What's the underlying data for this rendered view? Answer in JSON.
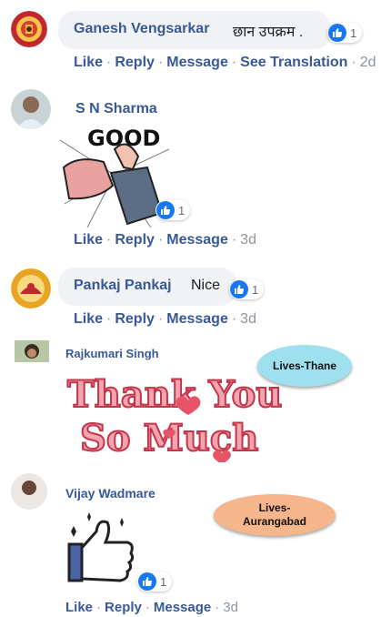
{
  "actions": {
    "like": "Like",
    "reply": "Reply",
    "message": "Message",
    "see_translation": "See Translation",
    "sep": "·"
  },
  "comments": [
    {
      "name": "Ganesh Vengsarkar",
      "text": "छान उपक्रम .",
      "likes": "1",
      "time": "2d"
    },
    {
      "name": "S N Sharma",
      "sticker_text": "GOOD",
      "likes": "1",
      "time": "3d"
    },
    {
      "name": "Pankaj Pankaj",
      "text": "Nice",
      "likes": "1",
      "time": "3d"
    },
    {
      "name": "Rajkumari Singh",
      "sticker_text": {
        "line1": "Thank You",
        "line2": "So Much"
      }
    },
    {
      "name": "Vijay Wadmare",
      "likes": "1",
      "time": "3d"
    }
  ],
  "callouts": {
    "thane": "Lives-Thane",
    "aurangabad_line1": "Lives-",
    "aurangabad_line2": "Aurangabad"
  },
  "colors": {
    "link": "#385898",
    "meta": "#8d949e",
    "like_blue": "#1877f2",
    "bubble": "#f0f2f5",
    "callout_blue": "#9fe0ee",
    "callout_orange": "#f6b68c"
  }
}
